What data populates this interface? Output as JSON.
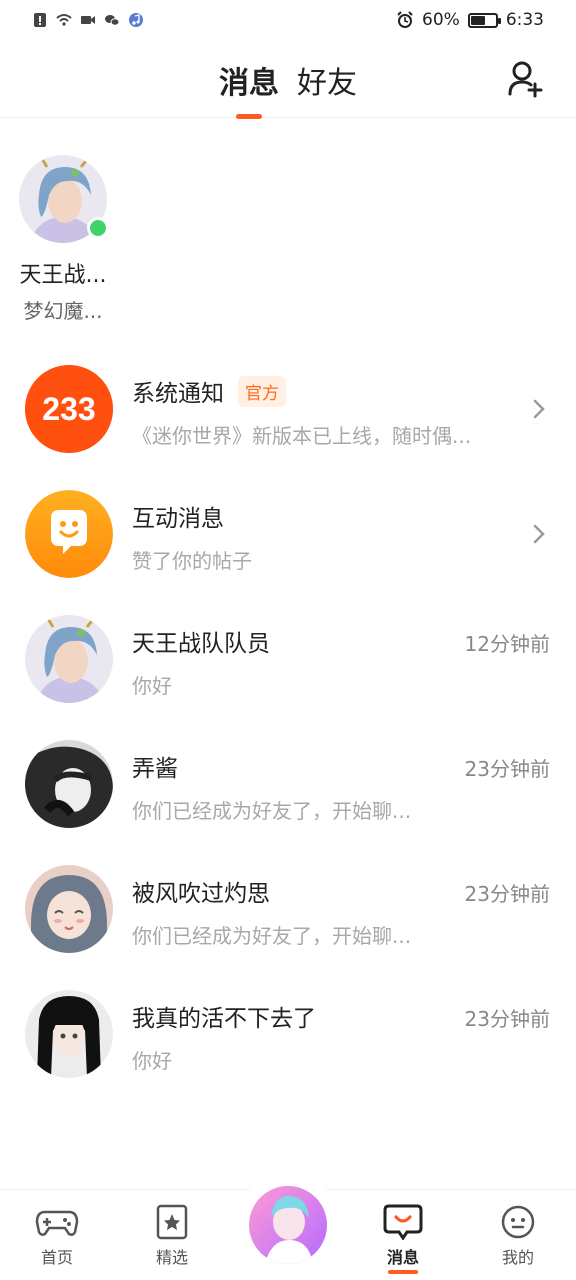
{
  "status_bar": {
    "battery": "60%",
    "time": "6:33",
    "battery_level": 0.6
  },
  "header": {
    "tabs": [
      {
        "label": "消息"
      },
      {
        "label": "好友"
      }
    ],
    "active_tab": "消息"
  },
  "top_friend": {
    "name": "天王战...",
    "game": "梦幻魔...",
    "online": true
  },
  "messages": [
    {
      "title": "系统通知",
      "badge": "官方",
      "subtitle": "《迷你世界》新版本已上线，随时偶...",
      "time": "",
      "icon": "233-logo"
    },
    {
      "title": "互动消息",
      "subtitle": "赞了你的帖子",
      "time": "",
      "icon": "interaction-smile-icon"
    },
    {
      "title": "天王战队队员",
      "subtitle": "你好",
      "time": "12分钟前"
    },
    {
      "title": "弄酱",
      "subtitle": "你们已经成为好友了，开始聊...",
      "time": "23分钟前"
    },
    {
      "title": "被风吹过灼思",
      "subtitle": "你们已经成为好友了，开始聊...",
      "time": "23分钟前"
    },
    {
      "title": "我真的活不下去了",
      "subtitle": "你好",
      "time": "23分钟前"
    }
  ],
  "bottom_nav": {
    "items": [
      {
        "label": "首页",
        "icon": "gamepad-icon"
      },
      {
        "label": "精选",
        "icon": "star-card-icon"
      },
      {
        "label": "消息",
        "icon": "chat-bubble-icon",
        "active": true
      },
      {
        "label": "我的",
        "icon": "face-icon"
      }
    ]
  },
  "colors": {
    "accent": "#ff5a1f",
    "online": "#3fd36b",
    "badge_text": "#ff6a1f",
    "badge_bg": "#fff0e3"
  }
}
